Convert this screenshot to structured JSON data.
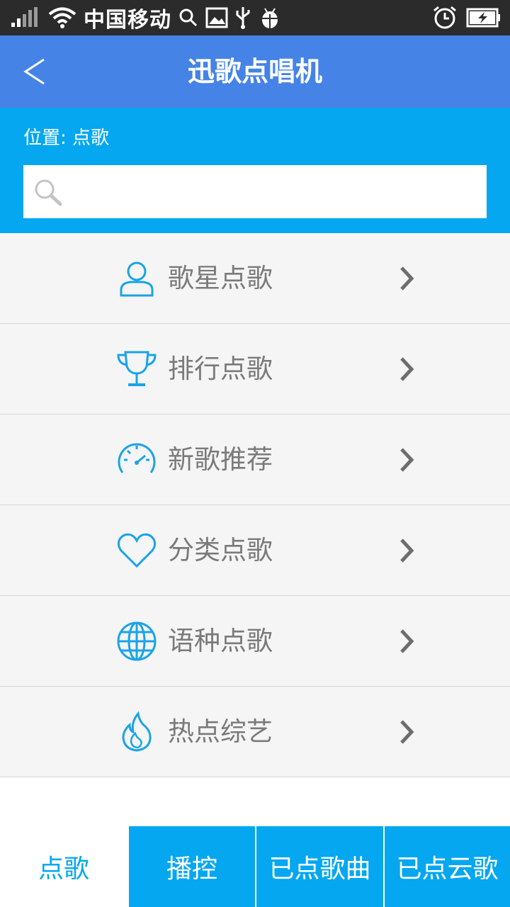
{
  "status_bar": {
    "carrier": "中国移动"
  },
  "header": {
    "title": "迅歌点唱机"
  },
  "location": {
    "text": "位置: 点歌"
  },
  "search": {
    "value": "",
    "placeholder": ""
  },
  "menu": {
    "items": [
      {
        "label": "歌星点歌",
        "icon": "singer-person-icon"
      },
      {
        "label": "排行点歌",
        "icon": "trophy-icon"
      },
      {
        "label": "新歌推荐",
        "icon": "speedometer-icon"
      },
      {
        "label": "分类点歌",
        "icon": "heart-icon"
      },
      {
        "label": "语种点歌",
        "icon": "globe-icon"
      },
      {
        "label": "热点综艺",
        "icon": "flame-icon"
      }
    ]
  },
  "tabs": [
    {
      "label": "点歌",
      "active": true
    },
    {
      "label": "播控",
      "active": false
    },
    {
      "label": "已点歌曲",
      "active": false
    },
    {
      "label": "已点云歌",
      "active": false
    }
  ],
  "colors": {
    "title_bar": "#4583e6",
    "accent": "#04a7f0",
    "list_bg": "#f5f5f5",
    "label_text": "#7a7a7a"
  }
}
